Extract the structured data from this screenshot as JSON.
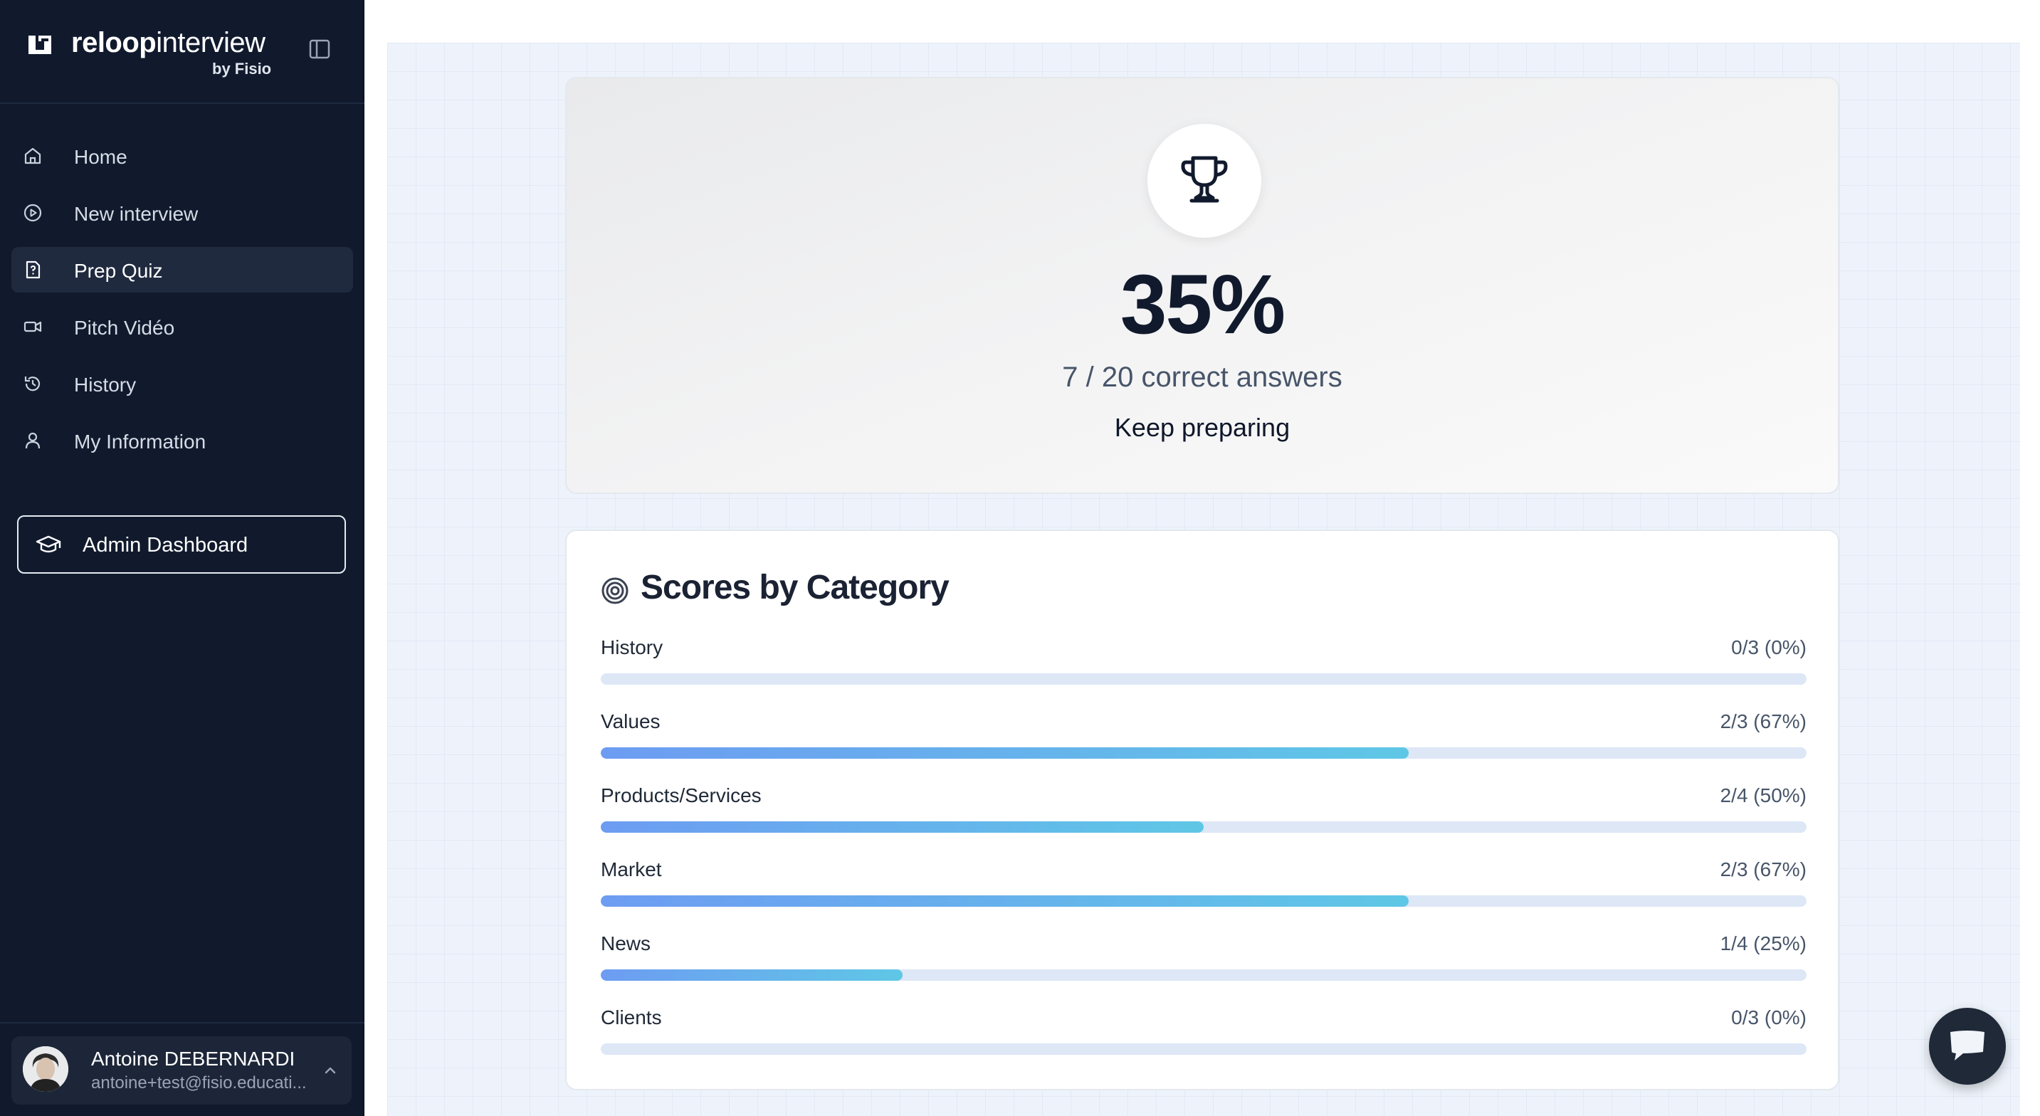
{
  "brand": {
    "name_bold": "reloop",
    "name_light": "interview",
    "sub": "by Fisio"
  },
  "sidebar": {
    "items": [
      {
        "label": "Home",
        "icon": "home-icon",
        "active": false
      },
      {
        "label": "New interview",
        "icon": "play-circle-icon",
        "active": false
      },
      {
        "label": "Prep Quiz",
        "icon": "quiz-file-icon",
        "active": true
      },
      {
        "label": "Pitch Vidéo",
        "icon": "video-icon",
        "active": false
      },
      {
        "label": "History",
        "icon": "history-icon",
        "active": false
      },
      {
        "label": "My Information",
        "icon": "user-icon",
        "active": false
      }
    ],
    "admin_label": "Admin Dashboard"
  },
  "user": {
    "name": "Antoine DEBERNARDI",
    "email": "antoine+test@fisio.educati..."
  },
  "result": {
    "percent": "35%",
    "correct_line": "7 / 20 correct answers",
    "message": "Keep preparing"
  },
  "categories_title": "Scores by Category",
  "categories": [
    {
      "name": "History",
      "score": "0/3 (0%)",
      "fraction": 0
    },
    {
      "name": "Values",
      "score": "2/3 (67%)",
      "fraction": 0.67
    },
    {
      "name": "Products/Services",
      "score": "2/4 (50%)",
      "fraction": 0.5
    },
    {
      "name": "Market",
      "score": "2/3 (67%)",
      "fraction": 0.67
    },
    {
      "name": "News",
      "score": "1/4 (25%)",
      "fraction": 0.25
    },
    {
      "name": "Clients",
      "score": "0/3 (0%)",
      "fraction": 0
    }
  ],
  "colors": {
    "sidebar_bg": "#111a2d",
    "active_item_bg": "#1f2a3f",
    "bar_start": "#6d9cf2",
    "bar_end": "#5fc7e6",
    "track": "#dde7f6"
  }
}
